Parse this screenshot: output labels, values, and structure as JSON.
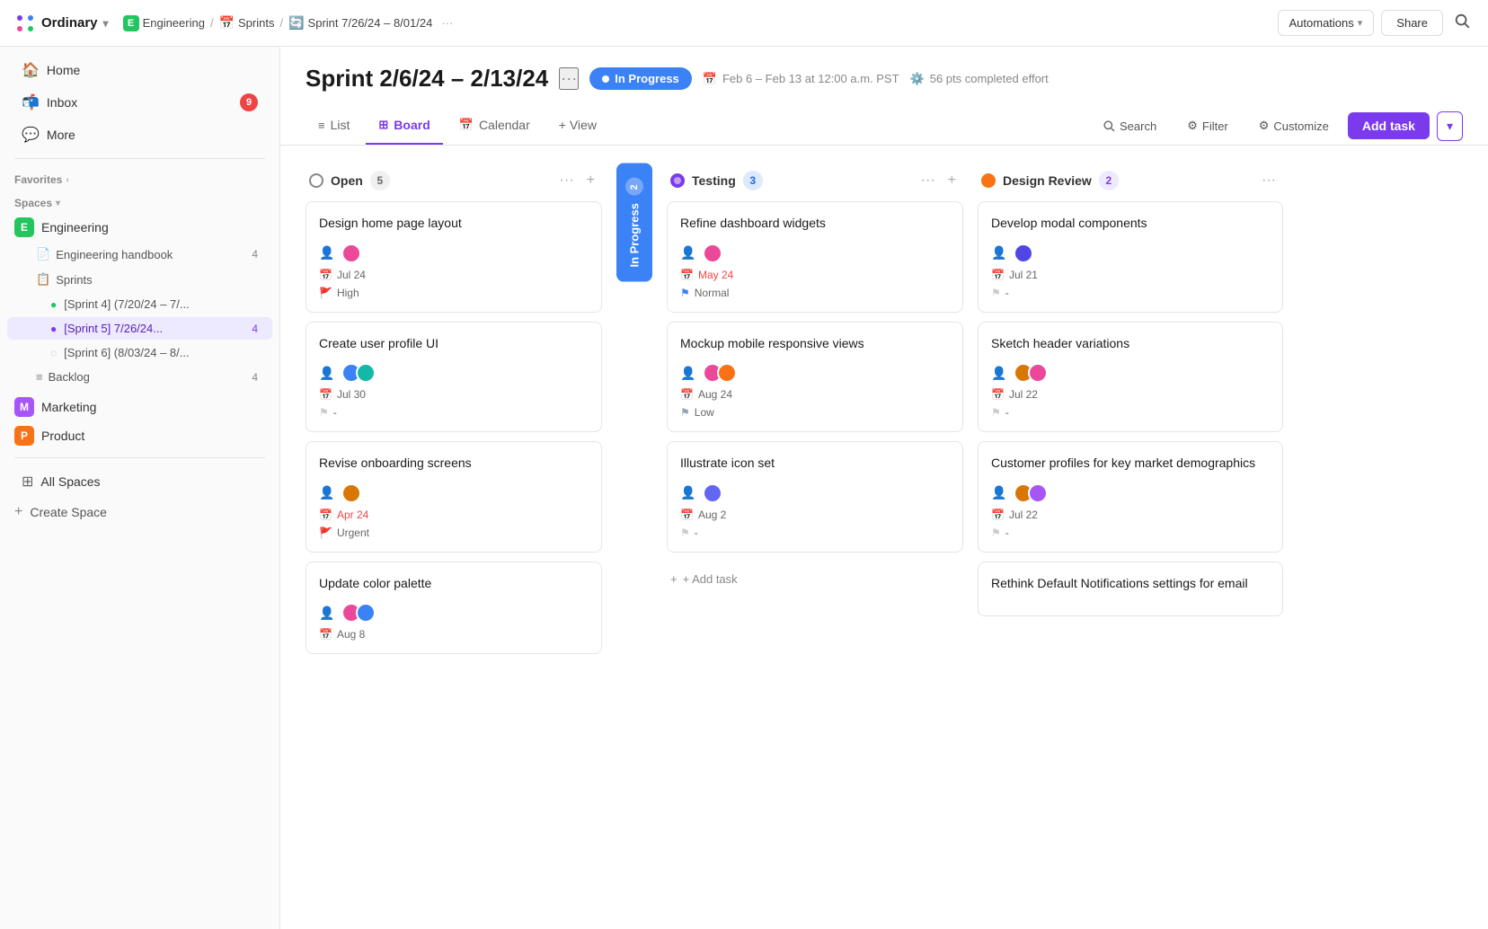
{
  "app": {
    "name": "Ordinary",
    "chevron": "▾"
  },
  "topnav": {
    "breadcrumb": [
      {
        "label": "Engineering",
        "icon": "E"
      },
      {
        "label": "Sprints"
      },
      {
        "label": "Sprint 7/26/24 – 8/01/24"
      }
    ],
    "more_btn": "···",
    "automations_label": "Automations",
    "share_label": "Share"
  },
  "sidebar": {
    "home_label": "Home",
    "inbox_label": "Inbox",
    "inbox_count": "9",
    "more_label": "More",
    "favorites_label": "Favorites",
    "spaces_label": "Spaces",
    "engineering_label": "Engineering",
    "engineering_badge": "E",
    "handbook_label": "Engineering handbook",
    "handbook_count": "4",
    "sprints_label": "Sprints",
    "sprint4_label": "[Sprint 4] (7/20/24 – 7/...",
    "sprint5_label": "[Sprint 5] 7/26/24...",
    "sprint5_count": "4",
    "sprint6_label": "[Sprint 6] (8/03/24 – 8/...",
    "backlog_label": "Backlog",
    "backlog_count": "4",
    "marketing_label": "Marketing",
    "marketing_badge": "M",
    "product_label": "Product",
    "product_badge": "P",
    "all_spaces_label": "All Spaces",
    "create_space_label": "Create Space"
  },
  "sprint": {
    "title": "Sprint 2/6/24 – 2/13/24",
    "status": "In Progress",
    "date_range": "Feb 6  – Feb 13 at 12:00 a.m. PST",
    "completed_effort": "56 pts completed effort"
  },
  "toolbar": {
    "list_label": "List",
    "board_label": "Board",
    "calendar_label": "Calendar",
    "view_label": "+ View",
    "search_label": "Search",
    "filter_label": "Filter",
    "customize_label": "Customize",
    "add_task_label": "Add task"
  },
  "columns": [
    {
      "id": "open",
      "title": "Open",
      "count": "5",
      "status_type": "open",
      "cards": [
        {
          "title": "Design home page layout",
          "avatar_colors": [
            "pink"
          ],
          "date": "Jul 24",
          "date_color": "normal",
          "priority": "High",
          "priority_type": "high"
        },
        {
          "title": "Create user profile UI",
          "avatar_colors": [
            "blue",
            "teal"
          ],
          "date": "Jul 30",
          "date_color": "normal",
          "priority": "-",
          "priority_type": "none"
        },
        {
          "title": "Revise onboarding screens",
          "avatar_colors": [
            "amber"
          ],
          "date": "Apr 24",
          "date_color": "red",
          "priority": "Urgent",
          "priority_type": "urgent"
        },
        {
          "title": "Update color palette",
          "avatar_colors": [
            "pink",
            "blue"
          ],
          "date": "Aug 8",
          "date_color": "normal",
          "priority": "",
          "priority_type": "none"
        }
      ]
    },
    {
      "id": "testing",
      "title": "Testing",
      "count": "3",
      "status_type": "testing",
      "cards": [
        {
          "title": "Refine dashboard widgets",
          "avatar_colors": [
            "pink"
          ],
          "date": "May 24",
          "date_color": "red",
          "priority": "Normal",
          "priority_type": "normal"
        },
        {
          "title": "Mockup mobile responsive views",
          "avatar_colors": [
            "pink",
            "orange"
          ],
          "date": "Aug 24",
          "date_color": "normal",
          "priority": "Low",
          "priority_type": "low"
        },
        {
          "title": "Illustrate icon set",
          "avatar_colors": [
            "indigo"
          ],
          "date": "Aug 2",
          "date_color": "normal",
          "priority": "-",
          "priority_type": "none"
        }
      ]
    },
    {
      "id": "design-review",
      "title": "Design Review",
      "count": "2",
      "status_type": "design",
      "cards": [
        {
          "title": "Develop modal components",
          "avatar_colors": [
            "indigo2"
          ],
          "date": "Jul 21",
          "date_color": "normal",
          "priority": "-",
          "priority_type": "none"
        },
        {
          "title": "Sketch header variations",
          "avatar_colors": [
            "amber2",
            "purple"
          ],
          "date": "Jul 22",
          "date_color": "normal",
          "priority": "-",
          "priority_type": "none"
        },
        {
          "title": "Customer profiles for key market demographics",
          "avatar_colors": [
            "amber3",
            "pink2"
          ],
          "date": "Jul 22",
          "date_color": "normal",
          "priority": "-",
          "priority_type": "none"
        },
        {
          "title": "Rethink Default Notifications settings for email",
          "avatar_colors": [],
          "date": "",
          "date_color": "normal",
          "priority": "",
          "priority_type": "none"
        }
      ]
    }
  ],
  "in_progress": {
    "label": "In Progress",
    "count": "2"
  },
  "add_task_label": "+ Add task"
}
